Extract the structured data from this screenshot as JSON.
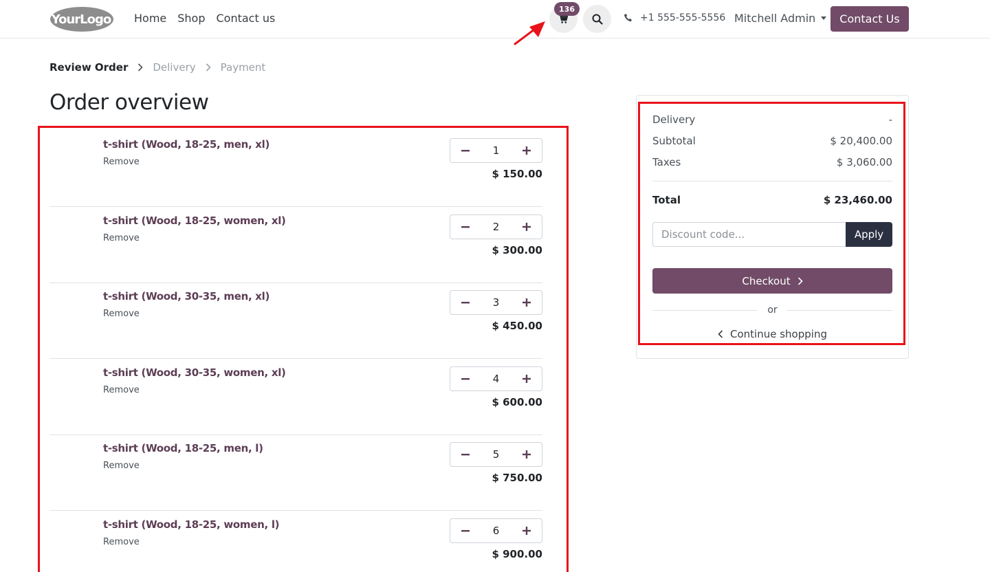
{
  "header": {
    "logo_text": "YourLogo",
    "nav": [
      "Home",
      "Shop",
      "Contact us"
    ],
    "cart_count": "136",
    "phone": "+1 555-555-5556",
    "user": "Mitchell Admin",
    "contact_button": "Contact Us"
  },
  "checkout_steps": {
    "review": "Review Order",
    "delivery": "Delivery",
    "payment": "Payment"
  },
  "page_title": "Order overview",
  "order_lines": [
    {
      "name": "t-shirt (Wood, 18-25, men, xl)",
      "remove": "Remove",
      "qty": "1",
      "price": "$ 150.00"
    },
    {
      "name": "t-shirt (Wood, 18-25, women, xl)",
      "remove": "Remove",
      "qty": "2",
      "price": "$ 300.00"
    },
    {
      "name": "t-shirt (Wood, 30-35, men, xl)",
      "remove": "Remove",
      "qty": "3",
      "price": "$ 450.00"
    },
    {
      "name": "t-shirt (Wood, 30-35, women, xl)",
      "remove": "Remove",
      "qty": "4",
      "price": "$ 600.00"
    },
    {
      "name": "t-shirt (Wood, 18-25, men, l)",
      "remove": "Remove",
      "qty": "5",
      "price": "$ 750.00"
    },
    {
      "name": "t-shirt (Wood, 18-25, women, l)",
      "remove": "Remove",
      "qty": "6",
      "price": "$ 900.00"
    }
  ],
  "summary": {
    "delivery_label": "Delivery",
    "delivery_value": "-",
    "subtotal_label": "Subtotal",
    "subtotal_value": "$ 20,400.00",
    "taxes_label": "Taxes",
    "taxes_value": "$ 3,060.00",
    "total_label": "Total",
    "total_value": "$ 23,460.00",
    "discount_placeholder": "Discount code...",
    "apply_label": "Apply",
    "checkout_label": "Checkout",
    "or_label": "or",
    "continue_label": "Continue shopping"
  },
  "colors": {
    "brand": "#714b67",
    "dark_button": "#2b3041",
    "highlight": "#e8131a"
  },
  "icons": [
    "cart-icon",
    "search-icon",
    "phone-icon",
    "chevron-right-icon",
    "chevron-left-icon",
    "minus-icon",
    "plus-icon",
    "annotation-arrow"
  ]
}
